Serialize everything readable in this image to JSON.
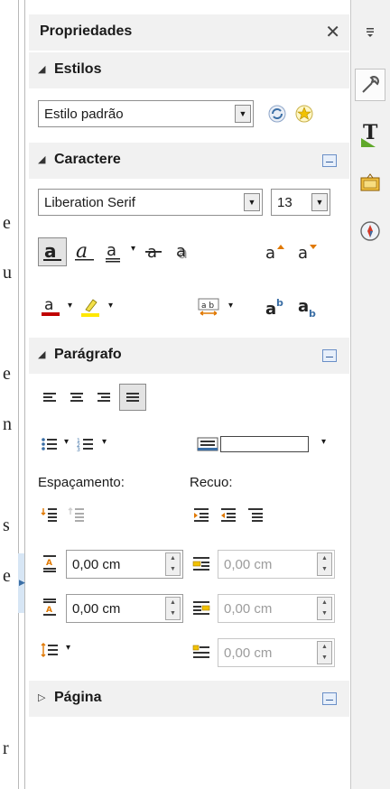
{
  "document": {
    "letters": [
      "e",
      "u",
      "e",
      "n",
      "s",
      "e",
      "r"
    ]
  },
  "panel": {
    "title": "Propriedades",
    "close_glyph": "✕"
  },
  "estilos": {
    "title": "Estilos",
    "style_value": "Estilo padrão"
  },
  "caractere": {
    "title": "Caractere",
    "font_value": "Liberation Serif",
    "size_value": "13"
  },
  "paragrafo": {
    "title": "Parágrafo",
    "spacing_label": "Espaçamento:",
    "indent_label": "Recuo:",
    "above_value": "0,00 cm",
    "below_value": "0,00 cm",
    "indent_before_value": "0,00 cm",
    "indent_after_value": "0,00 cm",
    "first_line_value": "0,00 cm"
  },
  "pagina": {
    "title": "Página"
  },
  "tabbar": {
    "items": [
      "menu-icon",
      "properties-icon",
      "styles-icon",
      "gallery-icon",
      "navigator-icon"
    ]
  },
  "colors": {
    "accent": "#3a6ea5",
    "font_color": "#c00000",
    "highlight": "#ffe800",
    "header_bg": "#f1f1f1"
  }
}
